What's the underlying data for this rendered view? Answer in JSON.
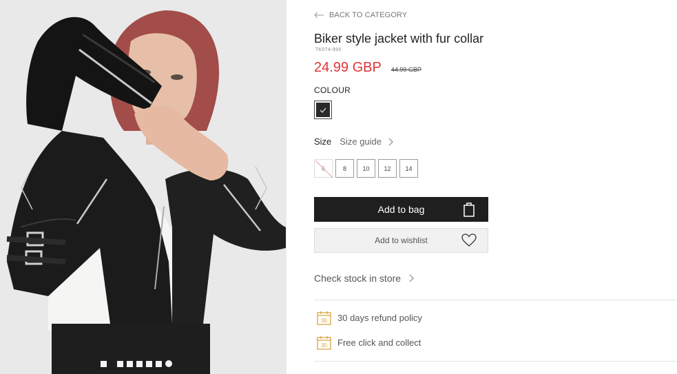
{
  "gallery": {
    "prev_icon": "chevron-left-icon",
    "next_icon": "chevron-right-icon",
    "image_count": 7,
    "active_index": 6
  },
  "product": {
    "back_label": "BACK TO CATEGORY",
    "title": "Biker style jacket with fur collar",
    "sku": "TK074-99X",
    "price": "24.99 GBP",
    "old_price": "44.99 GBP",
    "colour_label": "COLOUR",
    "colour_swatch": "#2a2a2a",
    "size_label": "Size",
    "size_guide": "Size guide",
    "sizes": [
      {
        "label": "6",
        "available": false
      },
      {
        "label": "8",
        "available": true
      },
      {
        "label": "10",
        "available": true
      },
      {
        "label": "12",
        "available": true
      },
      {
        "label": "14",
        "available": true
      }
    ],
    "add_to_bag": "Add to bag",
    "add_to_wishlist": "Add to wishlist",
    "check_stock": "Check stock in store",
    "perks": [
      {
        "icon": "calendar-30-icon",
        "label": "30 days refund policy"
      },
      {
        "icon": "calendar-30-icon",
        "label": "Free click and collect"
      }
    ]
  },
  "colors": {
    "price": "#e03535",
    "button_dark": "#1f1f1f",
    "perk_icon": "#d9a441"
  }
}
